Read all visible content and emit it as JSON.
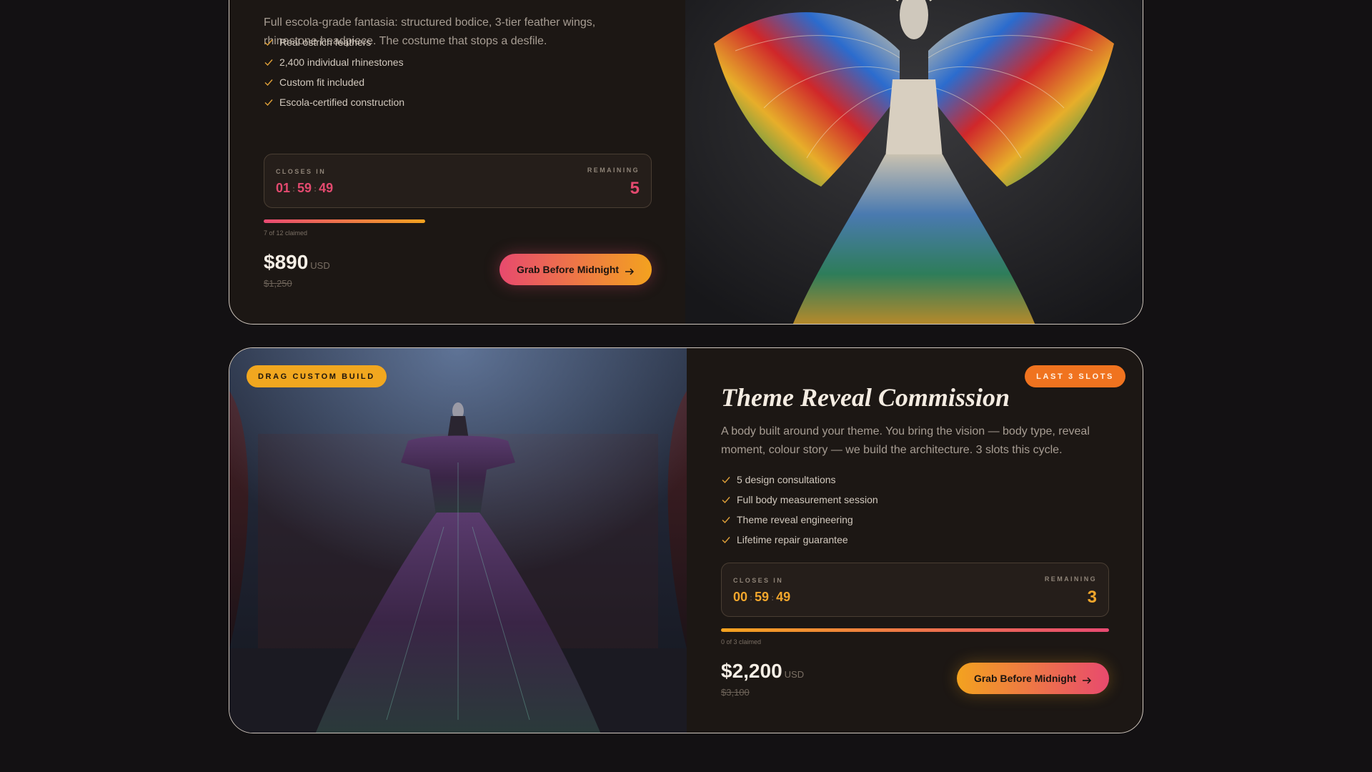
{
  "products": [
    {
      "description": "Full escola-grade fantasia: structured bodice, 3-tier feather wings, rhinestone headpiece. The costume that stops a desfile.",
      "features": [
        "Real ostrich feathers",
        "2,400 individual rhinestones",
        "Custom fit included",
        "Escola-certified construction"
      ],
      "closes_in_label": "CLOSES IN",
      "countdown": {
        "hours": "01",
        "minutes": "59",
        "seconds": "49"
      },
      "remaining_label": "REMAINING",
      "remaining": "5",
      "claimed_text": "7 of 12 claimed",
      "claimed_fraction": 0.4167,
      "price": "$890",
      "currency": "USD",
      "old_price": "$1,250",
      "cta_label": "Grab Before Midnight",
      "image_icon": "feathered-carnival-costume-photo"
    },
    {
      "badge_left": "DRAG CUSTOM BUILD",
      "badge_right": "LAST 3 SLOTS",
      "title": "Theme Reveal Commission",
      "description": "A body built around your theme. You bring the vision — body type, reveal moment, colour story — we build the architecture. 3 slots this cycle.",
      "features": [
        "5 design consultations",
        "Full body measurement session",
        "Theme reveal engineering",
        "Lifetime repair guarantee"
      ],
      "closes_in_label": "CLOSES IN",
      "countdown": {
        "hours": "00",
        "minutes": "59",
        "seconds": "49"
      },
      "remaining_label": "REMAINING",
      "remaining": "3",
      "claimed_text": "0 of 3 claimed",
      "claimed_fraction": 1.0,
      "price": "$2,200",
      "currency": "USD",
      "old_price": "$3,100",
      "cta_label": "Grab Before Midnight",
      "image_icon": "feathered-gown-on-stage-photo"
    }
  ],
  "colors": {
    "page_bg": "#131113",
    "card_bg": "#1c1714",
    "accent_pink": "#e84a6e",
    "accent_amber": "#f3a21f",
    "badge_orange": "#f0731f"
  }
}
